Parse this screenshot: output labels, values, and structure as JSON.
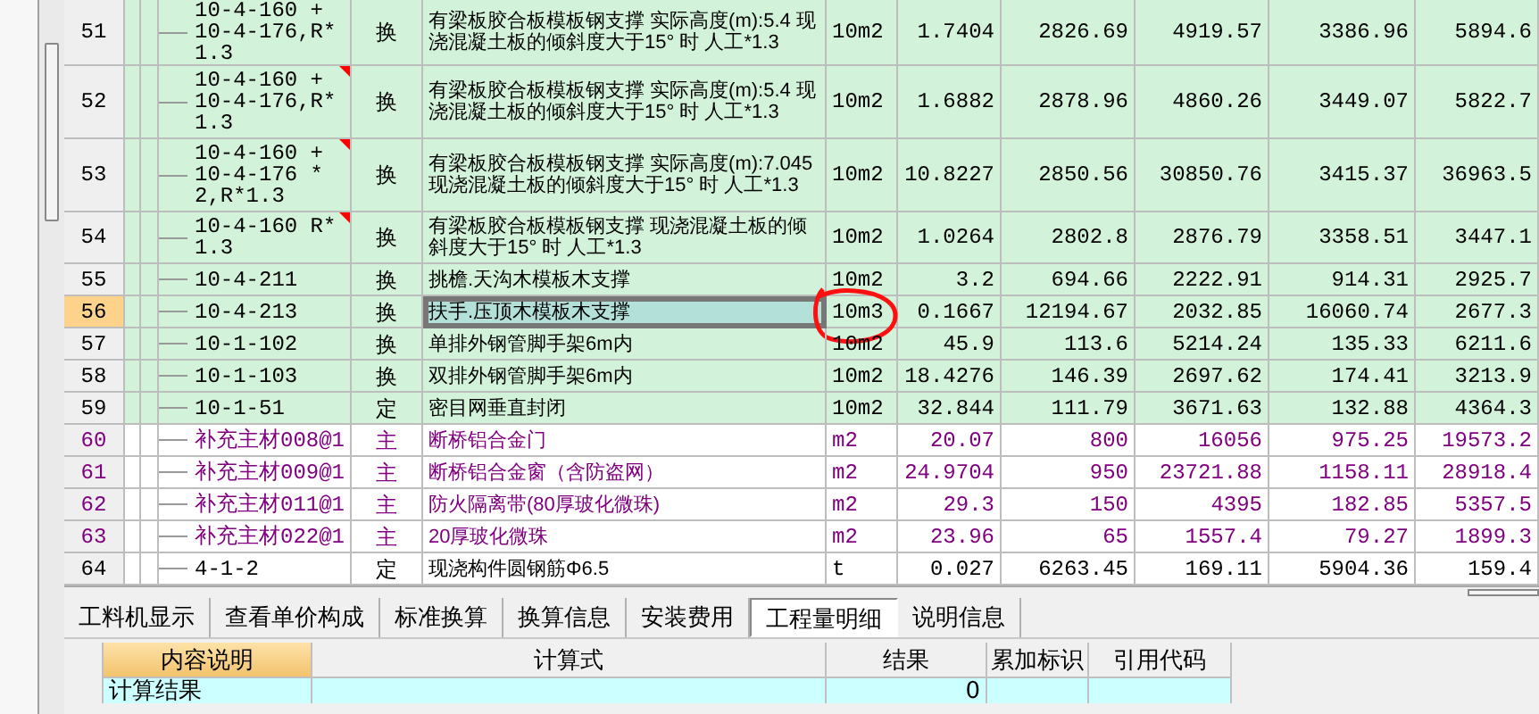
{
  "quota_table": {
    "rows": [
      {
        "number": "51",
        "code": "10-4-160 + 10-4-176,R*1.3",
        "flagged": false,
        "type": "换",
        "kind": "quota",
        "name": "有梁板胶合板模板钢支撑 实际高度(m):5.4 现浇混凝土板的倾斜度大于15° 时 人工*1.3",
        "unit": "10m2",
        "quantity": "1.7404",
        "col_8": "2826.69",
        "col_9": "4919.57",
        "col_10": "3386.96",
        "col_11": "5894.6",
        "selected": false,
        "cell_selected": false,
        "annotated": false
      },
      {
        "number": "52",
        "code": "10-4-160 + 10-4-176,R*1.3",
        "flagged": true,
        "type": "换",
        "kind": "quota",
        "name": "有梁板胶合板模板钢支撑  实际高度(m):5.4  现浇混凝土板的倾斜度大于15° 时 人工*1.3",
        "unit": "10m2",
        "quantity": "1.6882",
        "col_8": "2878.96",
        "col_9": "4860.26",
        "col_10": "3449.07",
        "col_11": "5822.7",
        "selected": false,
        "cell_selected": false,
        "annotated": false
      },
      {
        "number": "53",
        "code": "10-4-160 + 10-4-176 * 2,R*1.3",
        "flagged": true,
        "type": "换",
        "kind": "quota",
        "name": "有梁板胶合板模板钢支撑 实际高度(m):7.045 现浇混凝土板的倾斜度大于15° 时 人工*1.3",
        "unit": "10m2",
        "quantity": "10.8227",
        "col_8": "2850.56",
        "col_9": "30850.76",
        "col_10": "3415.37",
        "col_11": "36963.5",
        "selected": false,
        "cell_selected": false,
        "annotated": false
      },
      {
        "number": "54",
        "code": "10-4-160 R*1.3",
        "flagged": true,
        "type": "换",
        "kind": "quota",
        "name": "有梁板胶合板模板钢支撑 现浇混凝土板的倾斜度大于15° 时 人工*1.3",
        "unit": "10m2",
        "quantity": "1.0264",
        "col_8": "2802.8",
        "col_9": "2876.79",
        "col_10": "3358.51",
        "col_11": "3447.1",
        "selected": false,
        "cell_selected": false,
        "annotated": false
      },
      {
        "number": "55",
        "code": "10-4-211",
        "flagged": false,
        "type": "换",
        "kind": "quota",
        "name": "挑檐.天沟木模板木支撑",
        "unit": "10m2",
        "quantity": "3.2",
        "col_8": "694.66",
        "col_9": "2222.91",
        "col_10": "914.31",
        "col_11": "2925.7",
        "selected": false,
        "cell_selected": false,
        "annotated": false
      },
      {
        "number": "56",
        "code": "10-4-213",
        "flagged": false,
        "type": "换",
        "kind": "quota",
        "name": "扶手.压顶木模板木支撑",
        "unit": "10m3",
        "quantity": "0.1667",
        "col_8": "12194.67",
        "col_9": "2032.85",
        "col_10": "16060.74",
        "col_11": "2677.3",
        "selected": true,
        "cell_selected": true,
        "annotated": true
      },
      {
        "number": "57",
        "code": "10-1-102",
        "flagged": false,
        "type": "换",
        "kind": "quota",
        "name": "单排外钢管脚手架6m内",
        "unit": "10m2",
        "quantity": "45.9",
        "col_8": "113.6",
        "col_9": "5214.24",
        "col_10": "135.33",
        "col_11": "6211.6",
        "selected": false,
        "cell_selected": false,
        "annotated": false
      },
      {
        "number": "58",
        "code": "10-1-103",
        "flagged": false,
        "type": "换",
        "kind": "quota",
        "name": "双排外钢管脚手架6m内",
        "unit": "10m2",
        "quantity": "18.4276",
        "col_8": "146.39",
        "col_9": "2697.62",
        "col_10": "174.41",
        "col_11": "3213.9",
        "selected": false,
        "cell_selected": false,
        "annotated": false
      },
      {
        "number": "59",
        "code": "10-1-51",
        "flagged": false,
        "type": "定",
        "kind": "quota",
        "name": "密目网垂直封闭",
        "unit": "10m2",
        "quantity": "32.844",
        "col_8": "111.79",
        "col_9": "3671.63",
        "col_10": "132.88",
        "col_11": "4364.3",
        "selected": false,
        "cell_selected": false,
        "annotated": false
      },
      {
        "number": "60",
        "code": "补充主材008@1",
        "flagged": false,
        "type": "主",
        "kind": "material",
        "name": "断桥铝合金门",
        "unit": "m2",
        "quantity": "20.07",
        "col_8": "800",
        "col_9": "16056",
        "col_10": "975.25",
        "col_11": "19573.2",
        "selected": false,
        "cell_selected": false,
        "annotated": false
      },
      {
        "number": "61",
        "code": "补充主材009@1",
        "flagged": false,
        "type": "主",
        "kind": "material",
        "name": "断桥铝合金窗（含防盗网）",
        "unit": "m2",
        "quantity": "24.9704",
        "col_8": "950",
        "col_9": "23721.88",
        "col_10": "1158.11",
        "col_11": "28918.4",
        "selected": false,
        "cell_selected": false,
        "annotated": false
      },
      {
        "number": "62",
        "code": "补充主材011@1",
        "flagged": false,
        "type": "主",
        "kind": "material",
        "name": "防火隔离带(80厚玻化微珠)",
        "unit": "m2",
        "quantity": "29.3",
        "col_8": "150",
        "col_9": "4395",
        "col_10": "182.85",
        "col_11": "5357.5",
        "selected": false,
        "cell_selected": false,
        "annotated": false
      },
      {
        "number": "63",
        "code": "补充主材022@1",
        "flagged": false,
        "type": "主",
        "kind": "material",
        "name": "20厚玻化微珠",
        "unit": "m2",
        "quantity": "23.96",
        "col_8": "65",
        "col_9": "1557.4",
        "col_10": "79.27",
        "col_11": "1899.3",
        "selected": false,
        "cell_selected": false,
        "annotated": false
      },
      {
        "number": "64",
        "code": "4-1-2",
        "flagged": false,
        "type": "定",
        "kind": "plain",
        "name": "现浇构件圆钢筋Φ6.5",
        "unit": "t",
        "quantity": "0.027",
        "col_8": "6263.45",
        "col_9": "169.11",
        "col_10": "5904.36",
        "col_11": "159.4",
        "selected": false,
        "cell_selected": false,
        "annotated": false
      }
    ]
  },
  "detail_tabs": [
    {
      "label": "工料机显示",
      "selected": false
    },
    {
      "label": "查看单价构成",
      "selected": false
    },
    {
      "label": "标准换算",
      "selected": false
    },
    {
      "label": "换算信息",
      "selected": false
    },
    {
      "label": "安装费用",
      "selected": false
    },
    {
      "label": "工程量明细",
      "selected": true
    },
    {
      "label": "说明信息",
      "selected": false
    }
  ],
  "detail_table": {
    "columns": [
      {
        "label": "内容说明",
        "selected": true
      },
      {
        "label": "计算式",
        "selected": false
      },
      {
        "label": "结果",
        "selected": false
      },
      {
        "label": "累加标识",
        "selected": false
      },
      {
        "label": "引用代码",
        "selected": false
      }
    ],
    "rows": [
      {
        "description": "计算结果",
        "formula": "",
        "result": "0"
      }
    ]
  }
}
